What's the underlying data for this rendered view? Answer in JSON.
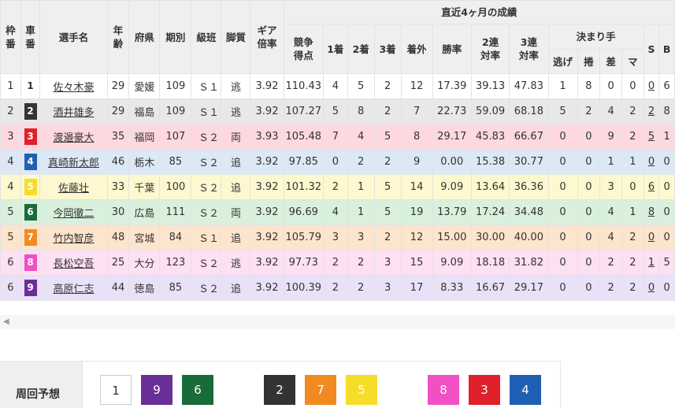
{
  "headers": {
    "waku": "枠番",
    "sha": "車番",
    "name": "選手名",
    "age": "年齢",
    "pref": "府県",
    "period": "期別",
    "class": "級班",
    "style": "脚質",
    "gear": "ギア倍率",
    "recent": "直近4ヶ月の成績",
    "score": "競争得点",
    "first": "1着",
    "second": "2着",
    "third": "3着",
    "out": "着外",
    "winrate": "勝率",
    "quinella": "2連対率",
    "trifecta": "3連対率",
    "kimarite": "決まり手",
    "nige": "逃げ",
    "makuri": "捲",
    "sashi": "差",
    "ma": "マ",
    "s": "S",
    "b": "B"
  },
  "riders": [
    {
      "waku": "1",
      "sha": "1",
      "name": "佐々木豪",
      "age": "29",
      "pref": "愛媛",
      "period": "109",
      "cls": "Ｓ１",
      "style": "逃",
      "gear": "3.92",
      "score": "110.43",
      "first": "4",
      "second": "5",
      "third": "2",
      "out": "12",
      "winrate": "17.39",
      "quinella": "39.13",
      "trifecta": "47.83",
      "nige": "1",
      "makuri": "8",
      "sashi": "0",
      "ma": "0",
      "s": "0",
      "b": "6",
      "bg": "#ffffff",
      "shaBg": "#ffffff",
      "shaFg": "#333333"
    },
    {
      "waku": "2",
      "sha": "2",
      "name": "酒井雄多",
      "age": "29",
      "pref": "福島",
      "period": "109",
      "cls": "Ｓ１",
      "style": "逃",
      "gear": "3.92",
      "score": "107.27",
      "first": "5",
      "second": "8",
      "third": "2",
      "out": "7",
      "winrate": "22.73",
      "quinella": "59.09",
      "trifecta": "68.18",
      "nige": "5",
      "makuri": "2",
      "sashi": "4",
      "ma": "2",
      "s": "2",
      "b": "8",
      "bg": "#e8e8e8",
      "shaBg": "#333333",
      "shaFg": "#ffffff"
    },
    {
      "waku": "3",
      "sha": "3",
      "name": "渡邉豪大",
      "age": "35",
      "pref": "福岡",
      "period": "107",
      "cls": "Ｓ２",
      "style": "両",
      "gear": "3.93",
      "score": "105.48",
      "first": "7",
      "second": "4",
      "third": "5",
      "out": "8",
      "winrate": "29.17",
      "quinella": "45.83",
      "trifecta": "66.67",
      "nige": "0",
      "makuri": "0",
      "sashi": "9",
      "ma": "2",
      "s": "5",
      "b": "1",
      "bg": "#fdd9df",
      "shaBg": "#e0202b",
      "shaFg": "#ffffff"
    },
    {
      "waku": "4",
      "sha": "4",
      "name": "真崎新太郎",
      "age": "46",
      "pref": "栃木",
      "period": "85",
      "cls": "Ｓ２",
      "style": "追",
      "gear": "3.92",
      "score": "97.85",
      "first": "0",
      "second": "2",
      "third": "2",
      "out": "9",
      "winrate": "0.00",
      "quinella": "15.38",
      "trifecta": "30.77",
      "nige": "0",
      "makuri": "0",
      "sashi": "1",
      "ma": "1",
      "s": "0",
      "b": "0",
      "bg": "#dce8f5",
      "shaBg": "#1f5fb4",
      "shaFg": "#ffffff"
    },
    {
      "waku": "4",
      "sha": "5",
      "name": "佐藤壮",
      "age": "33",
      "pref": "千葉",
      "period": "100",
      "cls": "Ｓ２",
      "style": "追",
      "gear": "3.92",
      "score": "101.32",
      "first": "2",
      "second": "1",
      "third": "5",
      "out": "14",
      "winrate": "9.09",
      "quinella": "13.64",
      "trifecta": "36.36",
      "nige": "0",
      "makuri": "0",
      "sashi": "3",
      "ma": "0",
      "s": "6",
      "b": "0",
      "bg": "#fdf8cf",
      "shaBg": "#f5dd2a",
      "shaFg": "#ffffff"
    },
    {
      "waku": "5",
      "sha": "6",
      "name": "今岡徹二",
      "age": "30",
      "pref": "広島",
      "period": "111",
      "cls": "Ｓ２",
      "style": "両",
      "gear": "3.92",
      "score": "96.69",
      "first": "4",
      "second": "1",
      "third": "5",
      "out": "19",
      "winrate": "13.79",
      "quinella": "17.24",
      "trifecta": "34.48",
      "nige": "0",
      "makuri": "0",
      "sashi": "4",
      "ma": "1",
      "s": "8",
      "b": "0",
      "bg": "#d9f0dc",
      "shaBg": "#1a6b3a",
      "shaFg": "#ffffff"
    },
    {
      "waku": "5",
      "sha": "7",
      "name": "竹内智彦",
      "age": "48",
      "pref": "宮城",
      "period": "84",
      "cls": "Ｓ１",
      "style": "追",
      "gear": "3.92",
      "score": "105.79",
      "first": "3",
      "second": "3",
      "third": "2",
      "out": "12",
      "winrate": "15.00",
      "quinella": "30.00",
      "trifecta": "40.00",
      "nige": "0",
      "makuri": "0",
      "sashi": "4",
      "ma": "2",
      "s": "0",
      "b": "0",
      "bg": "#fde4cc",
      "shaBg": "#f28a22",
      "shaFg": "#ffffff"
    },
    {
      "waku": "6",
      "sha": "8",
      "name": "長松空吾",
      "age": "25",
      "pref": "大分",
      "period": "123",
      "cls": "Ｓ２",
      "style": "逃",
      "gear": "3.92",
      "score": "97.73",
      "first": "2",
      "second": "2",
      "third": "3",
      "out": "15",
      "winrate": "9.09",
      "quinella": "18.18",
      "trifecta": "31.82",
      "nige": "0",
      "makuri": "0",
      "sashi": "2",
      "ma": "2",
      "s": "1",
      "b": "5",
      "bg": "#fde0f3",
      "shaBg": "#f14fc4",
      "shaFg": "#ffffff"
    },
    {
      "waku": "6",
      "sha": "9",
      "name": "高原仁志",
      "age": "44",
      "pref": "徳島",
      "period": "85",
      "cls": "Ｓ２",
      "style": "追",
      "gear": "3.92",
      "score": "100.39",
      "first": "2",
      "second": "2",
      "third": "3",
      "out": "17",
      "winrate": "8.33",
      "quinella": "16.67",
      "trifecta": "29.17",
      "nige": "0",
      "makuri": "0",
      "sashi": "2",
      "ma": "2",
      "s": "0",
      "b": "0",
      "bg": "#e9e1f7",
      "shaBg": "#6a2e99",
      "shaFg": "#ffffff"
    }
  ],
  "prediction": {
    "label": "周回予想",
    "boxes": [
      {
        "num": "1",
        "bg": "#ffffff",
        "fg": "#333333"
      },
      {
        "num": "9",
        "bg": "#6a2e99",
        "fg": "#ffffff"
      },
      {
        "num": "6",
        "bg": "#1a6b3a",
        "fg": "#ffffff"
      },
      {
        "num": "2",
        "bg": "#333333",
        "fg": "#ffffff"
      },
      {
        "num": "7",
        "bg": "#f28a22",
        "fg": "#ffffff"
      },
      {
        "num": "5",
        "bg": "#f5dd2a",
        "fg": "#ffffff"
      },
      {
        "num": "8",
        "bg": "#f14fc4",
        "fg": "#ffffff"
      },
      {
        "num": "3",
        "bg": "#e0202b",
        "fg": "#ffffff"
      },
      {
        "num": "4",
        "bg": "#1f5fb4",
        "fg": "#ffffff"
      }
    ]
  },
  "scroll": {
    "left_arrow": "◀"
  }
}
